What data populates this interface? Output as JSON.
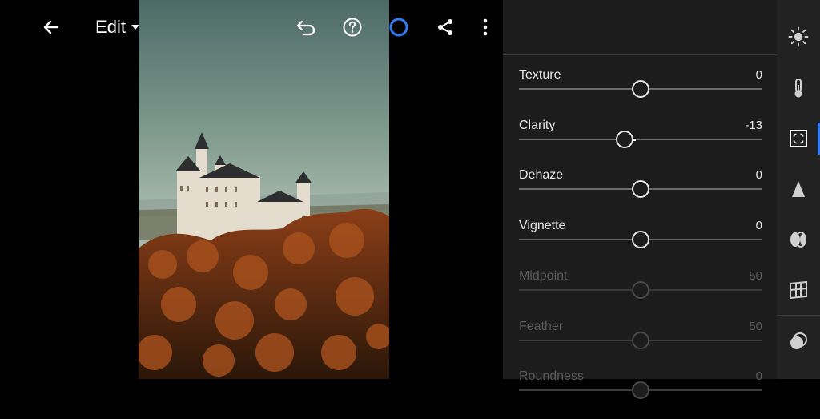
{
  "toolbar": {
    "back_icon": "back-arrow-icon",
    "edit_label": "Edit",
    "undo_icon": "undo-icon",
    "help_icon": "help-icon",
    "progress_icon": "circle-progress-icon",
    "share_icon": "share-icon",
    "more_icon": "more-vertical-icon"
  },
  "sliders": [
    {
      "label": "Texture",
      "value": "0",
      "position": 0.5,
      "enabled": true
    },
    {
      "label": "Clarity",
      "value": "-13",
      "position": 0.435,
      "enabled": true
    },
    {
      "label": "Dehaze",
      "value": "0",
      "position": 0.5,
      "enabled": true
    },
    {
      "label": "Vignette",
      "value": "0",
      "position": 0.5,
      "enabled": true
    },
    {
      "label": "Midpoint",
      "value": "50",
      "position": 0.5,
      "enabled": false
    },
    {
      "label": "Feather",
      "value": "50",
      "position": 0.5,
      "enabled": false
    },
    {
      "label": "Roundness",
      "value": "0",
      "position": 0.5,
      "enabled": false
    }
  ],
  "rail": {
    "items": [
      "light-icon",
      "color-temperature-icon",
      "effects-icon",
      "detail-icon",
      "optics-icon",
      "geometry-icon",
      "presets-icon"
    ],
    "active_index": 2,
    "accent": "#2f7df6"
  }
}
